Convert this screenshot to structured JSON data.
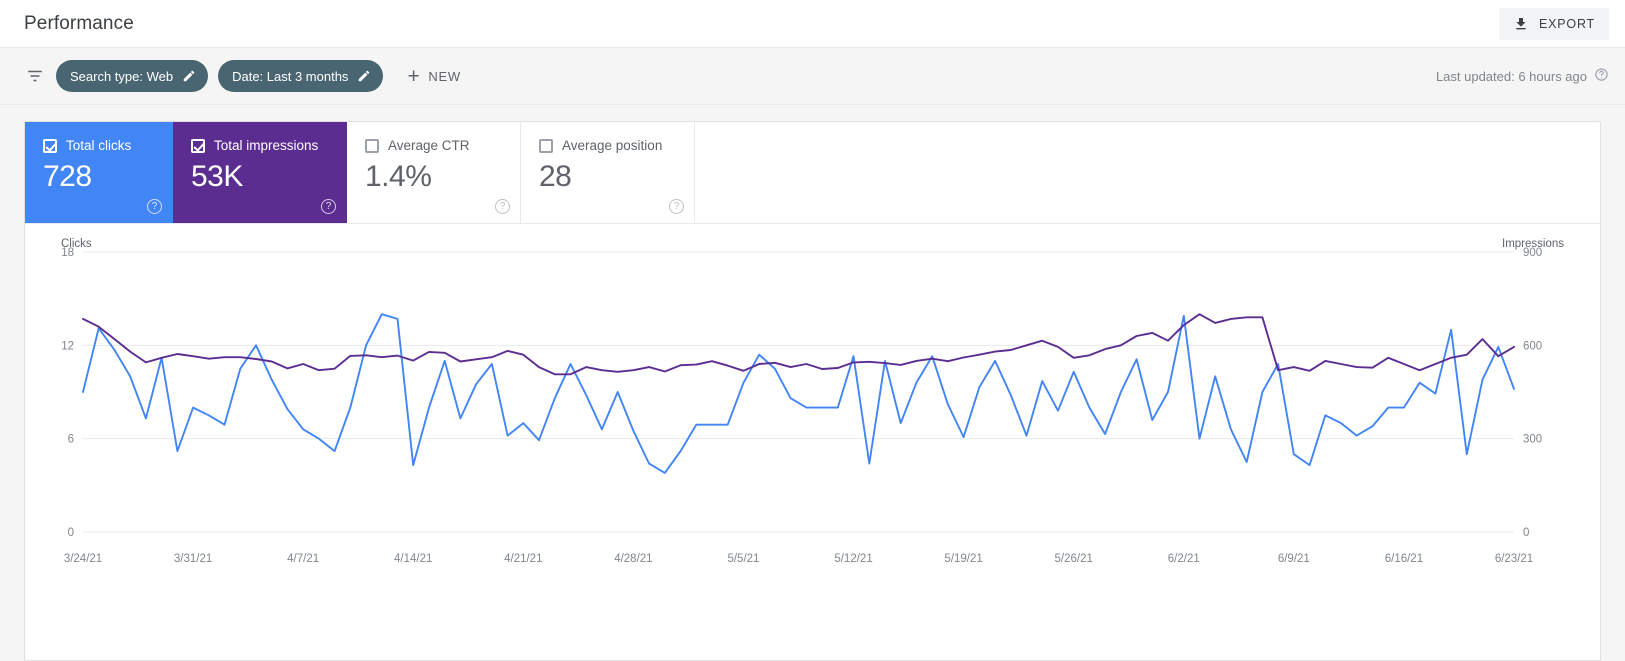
{
  "header": {
    "title": "Performance",
    "export_label": "EXPORT",
    "export_icon": "download-icon"
  },
  "filters": {
    "filter_icon": "filter-icon",
    "chips": [
      {
        "label": "Search type: Web",
        "edit_icon": "pencil-icon"
      },
      {
        "label": "Date: Last 3 months",
        "edit_icon": "pencil-icon"
      }
    ],
    "new_label": "NEW",
    "new_icon": "plus-icon",
    "last_updated": "Last updated: 6 hours ago",
    "help_icon": "help-icon"
  },
  "metrics": [
    {
      "label": "Total clicks",
      "value": "728",
      "checked": true,
      "color": "#4285f4"
    },
    {
      "label": "Total impressions",
      "value": "53K",
      "checked": true,
      "color": "#5c2d91"
    },
    {
      "label": "Average CTR",
      "value": "1.4%",
      "checked": false,
      "color": "#5f6368"
    },
    {
      "label": "Average position",
      "value": "28",
      "checked": false,
      "color": "#5f6368"
    }
  ],
  "chart_data": {
    "type": "line",
    "title": "",
    "xlabel": "",
    "ylabel": "Clicks",
    "y2label": "Impressions",
    "ylim": [
      0,
      18
    ],
    "y2lim": [
      0,
      900
    ],
    "yticks": [
      "0",
      "6",
      "12",
      "18"
    ],
    "y2ticks": [
      "0",
      "300",
      "600",
      "900"
    ],
    "grid": true,
    "legend": "none",
    "x_tick_labels": [
      "3/24/21",
      "3/31/21",
      "4/7/21",
      "4/14/21",
      "4/21/21",
      "4/28/21",
      "5/5/21",
      "5/12/21",
      "5/19/21",
      "5/26/21",
      "6/2/21",
      "6/9/21",
      "6/16/21",
      "6/23/21"
    ],
    "x_tick_indices": [
      0,
      7,
      14,
      21,
      28,
      35,
      42,
      49,
      56,
      63,
      70,
      77,
      84,
      91
    ],
    "series": [
      {
        "name": "Total clicks",
        "color": "#4285f4",
        "axis": "left",
        "values": [
          9.0,
          13.1,
          11.7,
          10.0,
          7.3,
          11.2,
          5.2,
          8.0,
          7.5,
          6.9,
          10.5,
          12.0,
          9.8,
          7.9,
          6.6,
          6.0,
          5.2,
          8.0,
          12.0,
          14.0,
          13.7,
          4.3,
          8.0,
          11.0,
          7.3,
          9.5,
          10.8,
          6.2,
          7.0,
          5.9,
          8.6,
          10.8,
          8.8,
          6.6,
          9.0,
          6.5,
          4.4,
          3.8,
          5.2,
          6.9,
          6.9,
          6.9,
          9.6,
          11.4,
          10.5,
          8.6,
          8.0,
          8.0,
          8.0,
          11.3,
          4.4,
          11.0,
          7.0,
          9.6,
          11.3,
          8.2,
          6.1,
          9.3,
          11.0,
          8.8,
          6.2,
          9.7,
          7.8,
          10.3,
          8.0,
          6.3,
          9.0,
          11.1,
          7.2,
          9.0,
          13.9,
          6.0,
          10.0,
          6.6,
          4.5,
          9.0,
          10.8,
          5.0,
          4.3,
          7.5,
          7.0,
          6.2,
          6.8,
          8.0,
          8.0,
          9.6,
          8.9,
          13.0,
          5.0,
          9.8,
          11.9,
          9.2
        ]
      },
      {
        "name": "Total impressions",
        "color": "#5c2d91",
        "axis": "right",
        "values": [
          685,
          660,
          620,
          580,
          545,
          560,
          572,
          565,
          557,
          562,
          562,
          556,
          548,
          526,
          540,
          520,
          525,
          566,
          568,
          562,
          567,
          551,
          579,
          576,
          548,
          555,
          562,
          582,
          570,
          530,
          507,
          507,
          530,
          520,
          515,
          520,
          530,
          516,
          536,
          538,
          549,
          535,
          518,
          540,
          544,
          530,
          540,
          524,
          527,
          545,
          547,
          543,
          537,
          550,
          557,
          549,
          561,
          570,
          580,
          585,
          600,
          615,
          595,
          560,
          568,
          588,
          600,
          630,
          640,
          615,
          665,
          700,
          672,
          685,
          690,
          690,
          520,
          530,
          518,
          550,
          540,
          530,
          528,
          560,
          540,
          520,
          540,
          560,
          570,
          620,
          565,
          595
        ]
      }
    ]
  }
}
